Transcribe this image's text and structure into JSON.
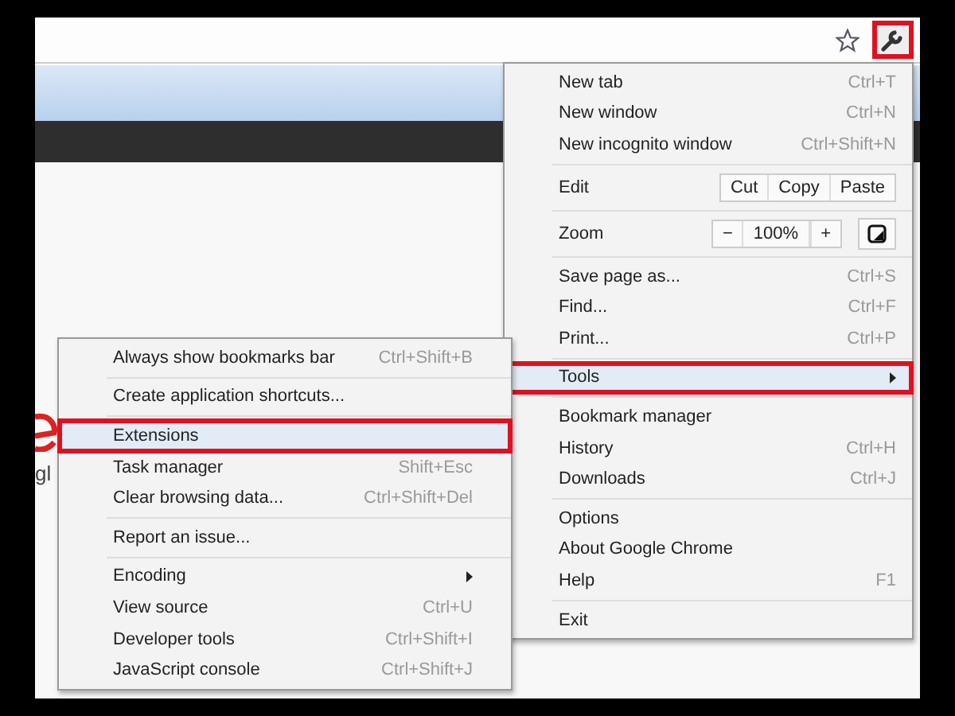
{
  "toolbar": {
    "wrench_outlined": true
  },
  "page": {
    "logo_fragment": "gl"
  },
  "menu": {
    "sections": [
      {
        "items": [
          {
            "kind": "item",
            "label": "New tab",
            "shortcut": "Ctrl+T",
            "selected": false,
            "outlined": false
          },
          {
            "kind": "item",
            "label": "New window",
            "shortcut": "Ctrl+N",
            "selected": false,
            "outlined": false
          },
          {
            "kind": "item",
            "label": "New incognito window",
            "shortcut": "Ctrl+Shift+N",
            "selected": false,
            "outlined": false
          }
        ]
      },
      {
        "items": [
          {
            "kind": "buttons",
            "label": "Edit",
            "buttons": [
              "Cut",
              "Copy",
              "Paste"
            ]
          }
        ]
      },
      {
        "items": [
          {
            "kind": "zoom",
            "label": "Zoom",
            "minus": "−",
            "value": "100%",
            "plus": "+"
          }
        ]
      },
      {
        "items": [
          {
            "kind": "item",
            "label": "Save page as...",
            "shortcut": "Ctrl+S",
            "selected": false,
            "outlined": false
          },
          {
            "kind": "item",
            "label": "Find...",
            "shortcut": "Ctrl+F",
            "selected": false,
            "outlined": false
          },
          {
            "kind": "item",
            "label": "Print...",
            "shortcut": "Ctrl+P",
            "selected": false,
            "outlined": false
          }
        ]
      },
      {
        "items": [
          {
            "kind": "submenu",
            "label": "Tools",
            "selected": true,
            "outlined": true
          }
        ]
      },
      {
        "items": [
          {
            "kind": "item",
            "label": "Bookmark manager",
            "selected": false,
            "outlined": false
          },
          {
            "kind": "item",
            "label": "History",
            "shortcut": "Ctrl+H",
            "selected": false,
            "outlined": false
          },
          {
            "kind": "item",
            "label": "Downloads",
            "shortcut": "Ctrl+J",
            "selected": false,
            "outlined": false
          }
        ]
      },
      {
        "items": [
          {
            "kind": "item",
            "label": "Options",
            "selected": false,
            "outlined": false
          },
          {
            "kind": "item",
            "label": "About Google Chrome",
            "selected": false,
            "outlined": false
          },
          {
            "kind": "item",
            "label": "Help",
            "shortcut": "F1",
            "selected": false,
            "outlined": false
          }
        ]
      },
      {
        "items": [
          {
            "kind": "item",
            "label": "Exit",
            "selected": false,
            "outlined": false
          }
        ]
      }
    ]
  },
  "submenu": {
    "sections": [
      {
        "items": [
          {
            "kind": "item",
            "label": "Always show bookmarks bar",
            "shortcut": "Ctrl+Shift+B",
            "selected": false,
            "outlined": false
          }
        ]
      },
      {
        "items": [
          {
            "kind": "item",
            "label": "Create application shortcuts...",
            "selected": false,
            "outlined": false
          }
        ]
      },
      {
        "items": [
          {
            "kind": "item",
            "label": "Extensions",
            "selected": true,
            "outlined": true
          },
          {
            "kind": "item",
            "label": "Task manager",
            "shortcut": "Shift+Esc",
            "selected": false,
            "outlined": false
          },
          {
            "kind": "item",
            "label": "Clear browsing data...",
            "shortcut": "Ctrl+Shift+Del",
            "selected": false,
            "outlined": false
          }
        ]
      },
      {
        "items": [
          {
            "kind": "item",
            "label": "Report an issue...",
            "selected": false,
            "outlined": false
          }
        ]
      },
      {
        "items": [
          {
            "kind": "submenu",
            "label": "Encoding",
            "selected": false,
            "outlined": false
          },
          {
            "kind": "item",
            "label": "View source",
            "shortcut": "Ctrl+U",
            "selected": false,
            "outlined": false
          },
          {
            "kind": "item",
            "label": "Developer tools",
            "shortcut": "Ctrl+Shift+I",
            "selected": false,
            "outlined": false
          },
          {
            "kind": "item",
            "label": "JavaScript console",
            "shortcut": "Ctrl+Shift+J",
            "selected": false,
            "outlined": false
          }
        ]
      }
    ]
  }
}
